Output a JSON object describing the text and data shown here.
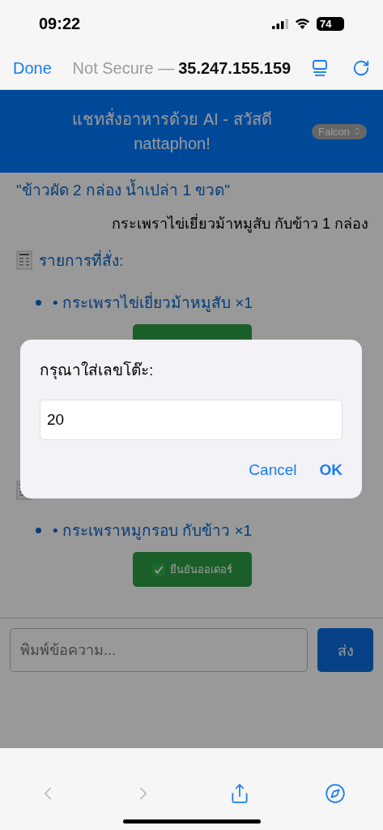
{
  "status_bar": {
    "time": "09:22",
    "battery": "74"
  },
  "browser_bar": {
    "done": "Done",
    "security": "Not Secure —",
    "address": "35.247.155.159"
  },
  "header": {
    "title": "แชทสั่งอาหารด้วย AI - สวัสดี nattaphon!",
    "model_select": "Falcon"
  },
  "messages": [
    {
      "kind": "bot",
      "text": "\"ข้าวผัด 2 กล่อง น้ำเปล่า 1 ขวด\""
    },
    {
      "kind": "user",
      "text": "กระเพราไข่เยี่ยวม้าหมูสับ กับข้าว 1 กล่อง"
    },
    {
      "kind": "order",
      "title": "รายการที่สั่ง:",
      "items": [
        "• กระเพราไข่เยี่ยวม้าหมูสับ ×1"
      ]
    },
    {
      "kind": "order",
      "items": [
        "• กระเพราหมูกรอบ กับข้าว ×1"
      ],
      "confirm": "ยืนยันออเดอร์"
    }
  ],
  "composer": {
    "placeholder": "พิมพ์ข้อความ...",
    "send": "ส่ง"
  },
  "dialog": {
    "title": "กรุณาใส่เลขโต๊ะ:",
    "value": "20",
    "buttons": [
      {
        "label": "Cancel",
        "primary": false
      },
      {
        "label": "OK",
        "primary": true
      }
    ]
  },
  "toolbar": [
    {
      "kind": "back",
      "disabled": true
    },
    {
      "kind": "forward",
      "disabled": true
    },
    {
      "kind": "share",
      "disabled": false
    },
    {
      "kind": "compass",
      "disabled": false
    }
  ]
}
